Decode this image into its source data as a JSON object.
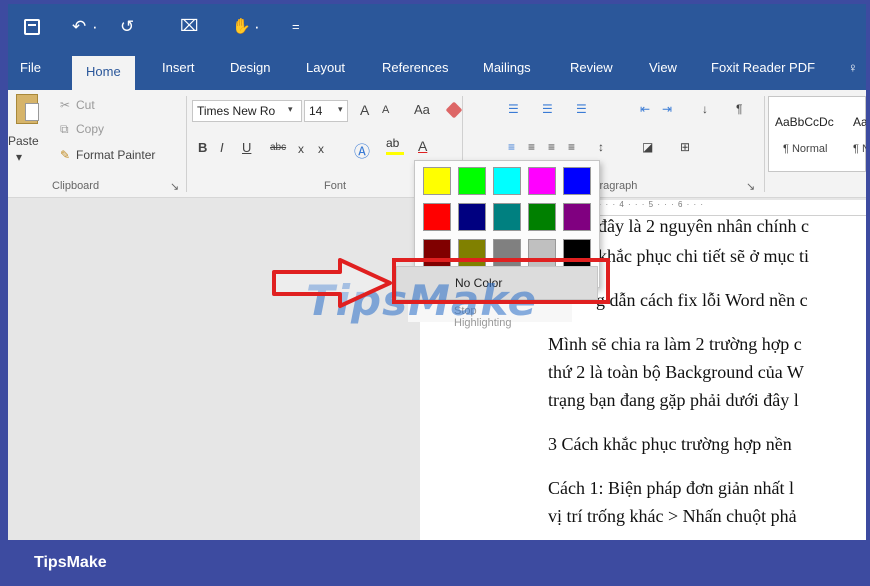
{
  "quick_access": {
    "save_icon": "save-icon",
    "undo_glyph": "↶",
    "undo_caret": "·",
    "redo_glyph": "↺",
    "touch_glyph": "⌧",
    "custom_glyph": "✋",
    "custom_caret": "·",
    "more_glyph": "="
  },
  "tabs": [
    "File",
    "Home",
    "Insert",
    "Design",
    "Layout",
    "References",
    "Mailings",
    "Review",
    "View",
    "Foxit Reader PDF"
  ],
  "tab_extra_glyph": "♀",
  "clipboard": {
    "paste_label": "Paste",
    "cut_label": "Cut",
    "copy_label": "Copy",
    "format_painter_label": "Format Painter",
    "group_label": "Clipboard"
  },
  "font": {
    "family": "Times New Ro",
    "size": "14",
    "grow": "A",
    "shrink": "A",
    "case": "Aa",
    "bold": "B",
    "italic": "I",
    "underline": "U",
    "strike": "abc",
    "subscript": "x",
    "superscript": "x",
    "group_label": "Font"
  },
  "paragraph": {
    "group_label": "Paragraph",
    "sort_glyph": "↓",
    "pilcrow_glyph": "¶"
  },
  "styles": {
    "normal_preview": "AaBbCcDc",
    "normal_label": "¶ Normal",
    "second_preview": "Aa",
    "second_label": "¶ N"
  },
  "ruler_text": "· · · 2 · · · 3 · · · 4 · · · 5 · · · 6 · · ·",
  "palette": {
    "colors": [
      [
        "#ffff00",
        "#00ff00",
        "#00ffff",
        "#ff00ff",
        "#0000ff"
      ],
      [
        "#ff0000",
        "#000080",
        "#008080",
        "#008000",
        "#800080"
      ],
      [
        "#800000",
        "#808000",
        "#808080",
        "#c0c0c0",
        "#000000"
      ]
    ],
    "no_color_label": "No Color",
    "stop_label": "Stop Highlighting"
  },
  "document": {
    "lines": [
      "đây là 2 nguyên nhân chính c",
      "khắc phục chi tiết sẽ ở mục ti",
      "g dẫn cách fix lỗi Word nền c",
      "Mình sẽ chia ra làm 2 trường hợp c",
      "thứ 2 là toàn bộ Background của W",
      "trạng bạn đang gặp phải dưới đây l",
      "3 Cách khắc phục trường hợp nền",
      "Cách 1: Biện pháp đơn giản nhất l",
      "vị trí trống khác > Nhấn chuột phả"
    ]
  },
  "watermark": "TipsMake",
  "footer": {
    "brand": "TipsMake"
  },
  "colors": {
    "word_blue": "#2b579a",
    "footer_blue": "#3d4ba0",
    "highlight_red": "#e02020"
  }
}
